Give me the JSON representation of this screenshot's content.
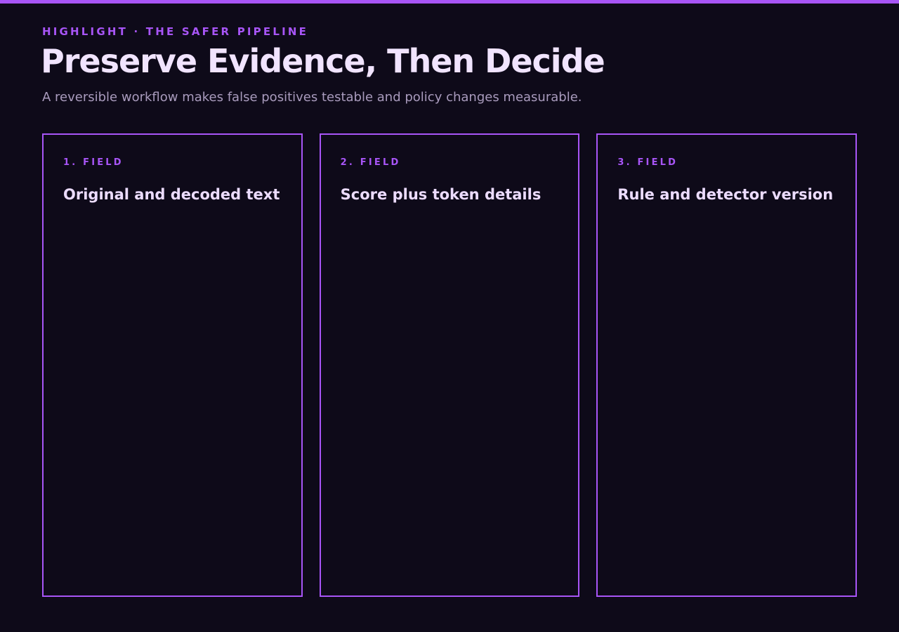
{
  "header": {
    "eyebrow": "HIGHLIGHT · THE SAFER PIPELINE",
    "title": "Preserve Evidence, Then Decide",
    "subtitle": "A reversible workflow makes false positives testable and policy changes measurable."
  },
  "cards": [
    {
      "kicker": "1. FIELD",
      "text": "Original and decoded text"
    },
    {
      "kicker": "2. FIELD",
      "text": "Score plus token details"
    },
    {
      "kicker": "3. FIELD",
      "text": "Rule and detector version"
    }
  ],
  "colors": {
    "background": "#0e0a19",
    "accent": "#a855f7",
    "title": "#f1e4ff",
    "subtitle": "#a99bbd"
  }
}
